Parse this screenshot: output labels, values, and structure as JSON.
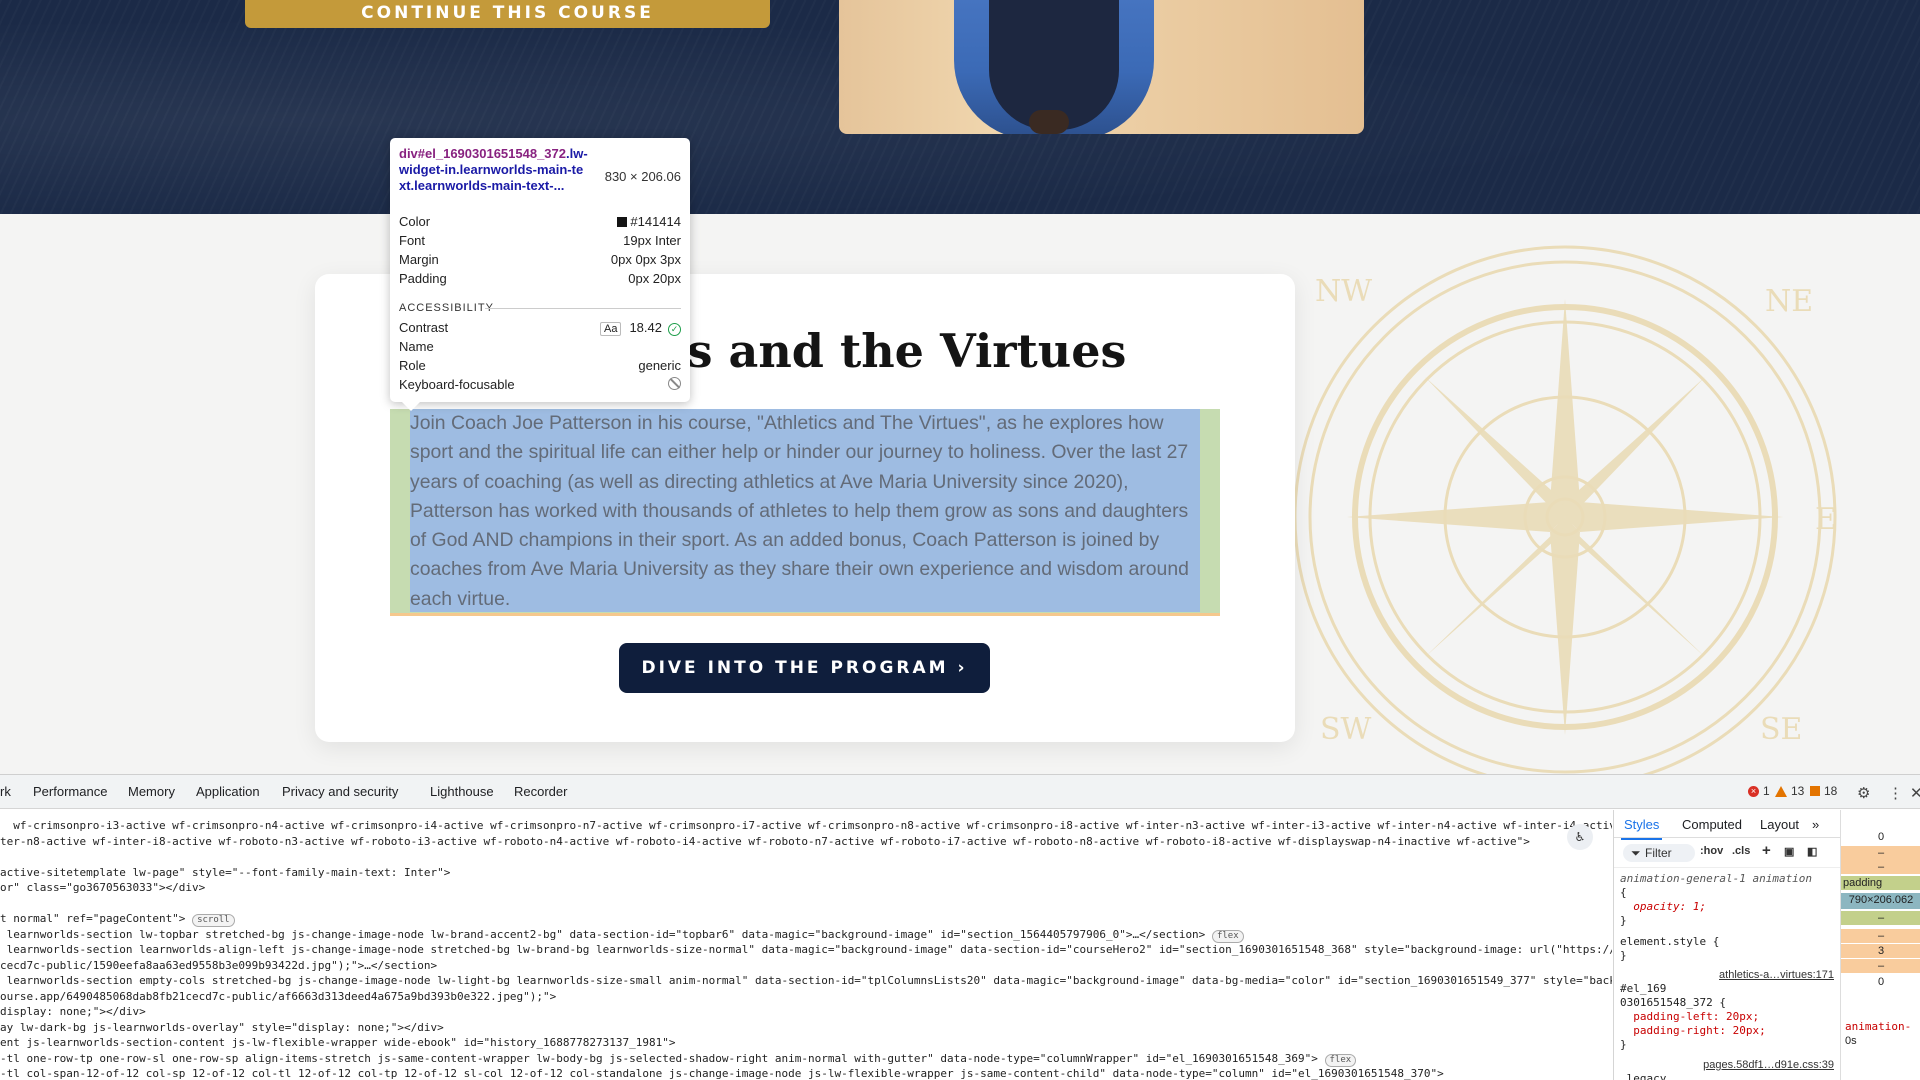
{
  "hero": {
    "continue_label": "CONTINUE THIS COURSE"
  },
  "card": {
    "title": "Athletics and the Virtues",
    "body": "Join Coach Joe Patterson in his course, \"Athletics and The Virtues\", as he explores how sport and the spiritual life can either help or hinder our journey to holiness. Over the last 27 years of coaching (as well as directing athletics at Ave Maria University since 2020), Patterson has worked with thousands of athletes to help them grow as sons and daughters of God AND champions in their sport. As an added bonus, Coach Patterson is joined by coaches from Ave Maria University as they share their own experience and wisdom around each virtue.",
    "cta_label": "DIVE INTO THE PROGRAM ›"
  },
  "compass": {
    "labels": [
      "NW",
      "NE",
      "E",
      "SW",
      "SE"
    ],
    "color": "#eadcb8"
  },
  "tooltip": {
    "selector_tag": "div#el_1690301651548_372",
    "selector_classes": ".lw-widget-in.learnworlds-main-text.learnworlds-main-text-...",
    "size": "830 × 206.06",
    "rows": [
      {
        "label": "Color",
        "value": "#141414"
      },
      {
        "label": "Font",
        "value": "19px Inter"
      },
      {
        "label": "Margin",
        "value": "0px 0px 3px"
      },
      {
        "label": "Padding",
        "value": "0px 20px"
      }
    ],
    "accessibility_heading": "ACCESSIBILITY",
    "contrast_label": "Contrast",
    "contrast_aa": "Aa",
    "contrast_value": "18.42",
    "name_label": "Name",
    "role_label": "Role",
    "role_value": "generic",
    "keyboard_label": "Keyboard-focusable"
  },
  "devtools": {
    "tabs": [
      "rk",
      "Performance",
      "Memory",
      "Application",
      "Privacy and security",
      "Lighthouse",
      "Recorder"
    ],
    "errors": "1",
    "warnings": "13",
    "issues": "18",
    "code_lines": [
      "  wf-crimsonpro-i3-active wf-crimsonpro-n4-active wf-crimsonpro-i4-active wf-crimsonpro-n7-active wf-crimsonpro-i7-active wf-crimsonpro-n8-active wf-crimsonpro-i8-active wf-inter-n3-active wf-inter-i3-active wf-inter-n4-active wf-inter-i4-active wf-inter-",
      "ter-n8-active wf-inter-i8-active wf-roboto-n3-active wf-roboto-i3-active wf-roboto-n4-active wf-roboto-i4-active wf-roboto-n7-active wf-roboto-i7-active wf-roboto-n8-active wf-roboto-i8-active wf-displayswap-n4-inactive wf-active\">",
      "active-sitetemplate lw-page\" style=\"--font-family-main-text: Inter\">",
      "or\" class=\"go3670563033\"></div>",
      "",
      "t normal\" ref=\"pageContent\">",
      " learnworlds-section lw-topbar stretched-bg js-change-image-node lw-brand-accent2-bg\" data-section-id=\"topbar6\" data-magic=\"background-image\" id=\"section_1564405797906_0\">…</section>",
      " learnworlds-section learnworlds-align-left js-change-image-node stretched-bg lw-brand-bg learnworlds-size-normal\" data-magic=\"background-image\" data-section-id=\"courseHero2\" id=\"section_1690301651548_368\" style=\"background-image: url(\"https://",
      "cecd7c-public/1590eefa8aa63ed9558b3e099b93422d.jpg\");\">…</section>",
      " learnworlds-section empty-cols stretched-bg js-change-image-node lw-light-bg learnworlds-size-small anim-normal\" data-section-id=\"tplColumnsLists20\" data-magic=\"background-image\" data-bg-media=\"color\" id=\"section_1690301651549_377\" style=\"back",
      "ourse.app/6490485068dab8fb21cecd7c-public/af6663d313deed4a675a9bd393b0e322.jpeg\");\">",
      "display: none;\"></div>",
      "ay lw-dark-bg js-learnworlds-overlay\" style=\"display: none;\"></div>",
      "ent js-learnworlds-section-content js-lw-flexible-wrapper wide-ebook\" id=\"history_1688778273137_1981\">",
      "-tl one-row-tp one-row-sl one-row-sp align-items-stretch js-same-content-wrapper lw-body-bg js-selected-shadow-right anim-normal with-gutter\" data-node-type=\"columnWrapper\" id=\"el_1690301651548_369\">",
      "-tl col-span-12-of-12 col-sp 12-of-12 col-tl 12-of-12 col-tp 12-of-12 sl-col 12-of-12 col-standalone js-change-image-node js-lw-flexible-wrapper js-same-content-child\" data-node-type=\"column\" id=\"el_1690301651548_370\">"
    ],
    "pills": {
      "scroll": "scroll",
      "flex": "flex"
    },
    "styles": {
      "tabs": [
        "Styles",
        "Computed",
        "Layout"
      ],
      "filter": "Filter",
      "hov": ":hov",
      "cls": ".cls",
      "rules": [
        "animation-general-1 animation",
        "{",
        "  opacity: 1;",
        "}",
        "element.style {",
        "}",
        "#el_169",
        "0301651548_372 {",
        "  padding-left: 20px;",
        "  padding-right: 20px;",
        "}",
        ".legacy"
      ],
      "source1": "athletics-a…virtues:171",
      "source2": "pages.58df1…d91e.css:39"
    },
    "boxmodel": {
      "top": "0",
      "padding_label": "padding",
      "content": "790×206.062",
      "dash": "–",
      "value3": "3",
      "bottom": "0",
      "animation_label": "animation-",
      "animation_value": "0s"
    }
  }
}
